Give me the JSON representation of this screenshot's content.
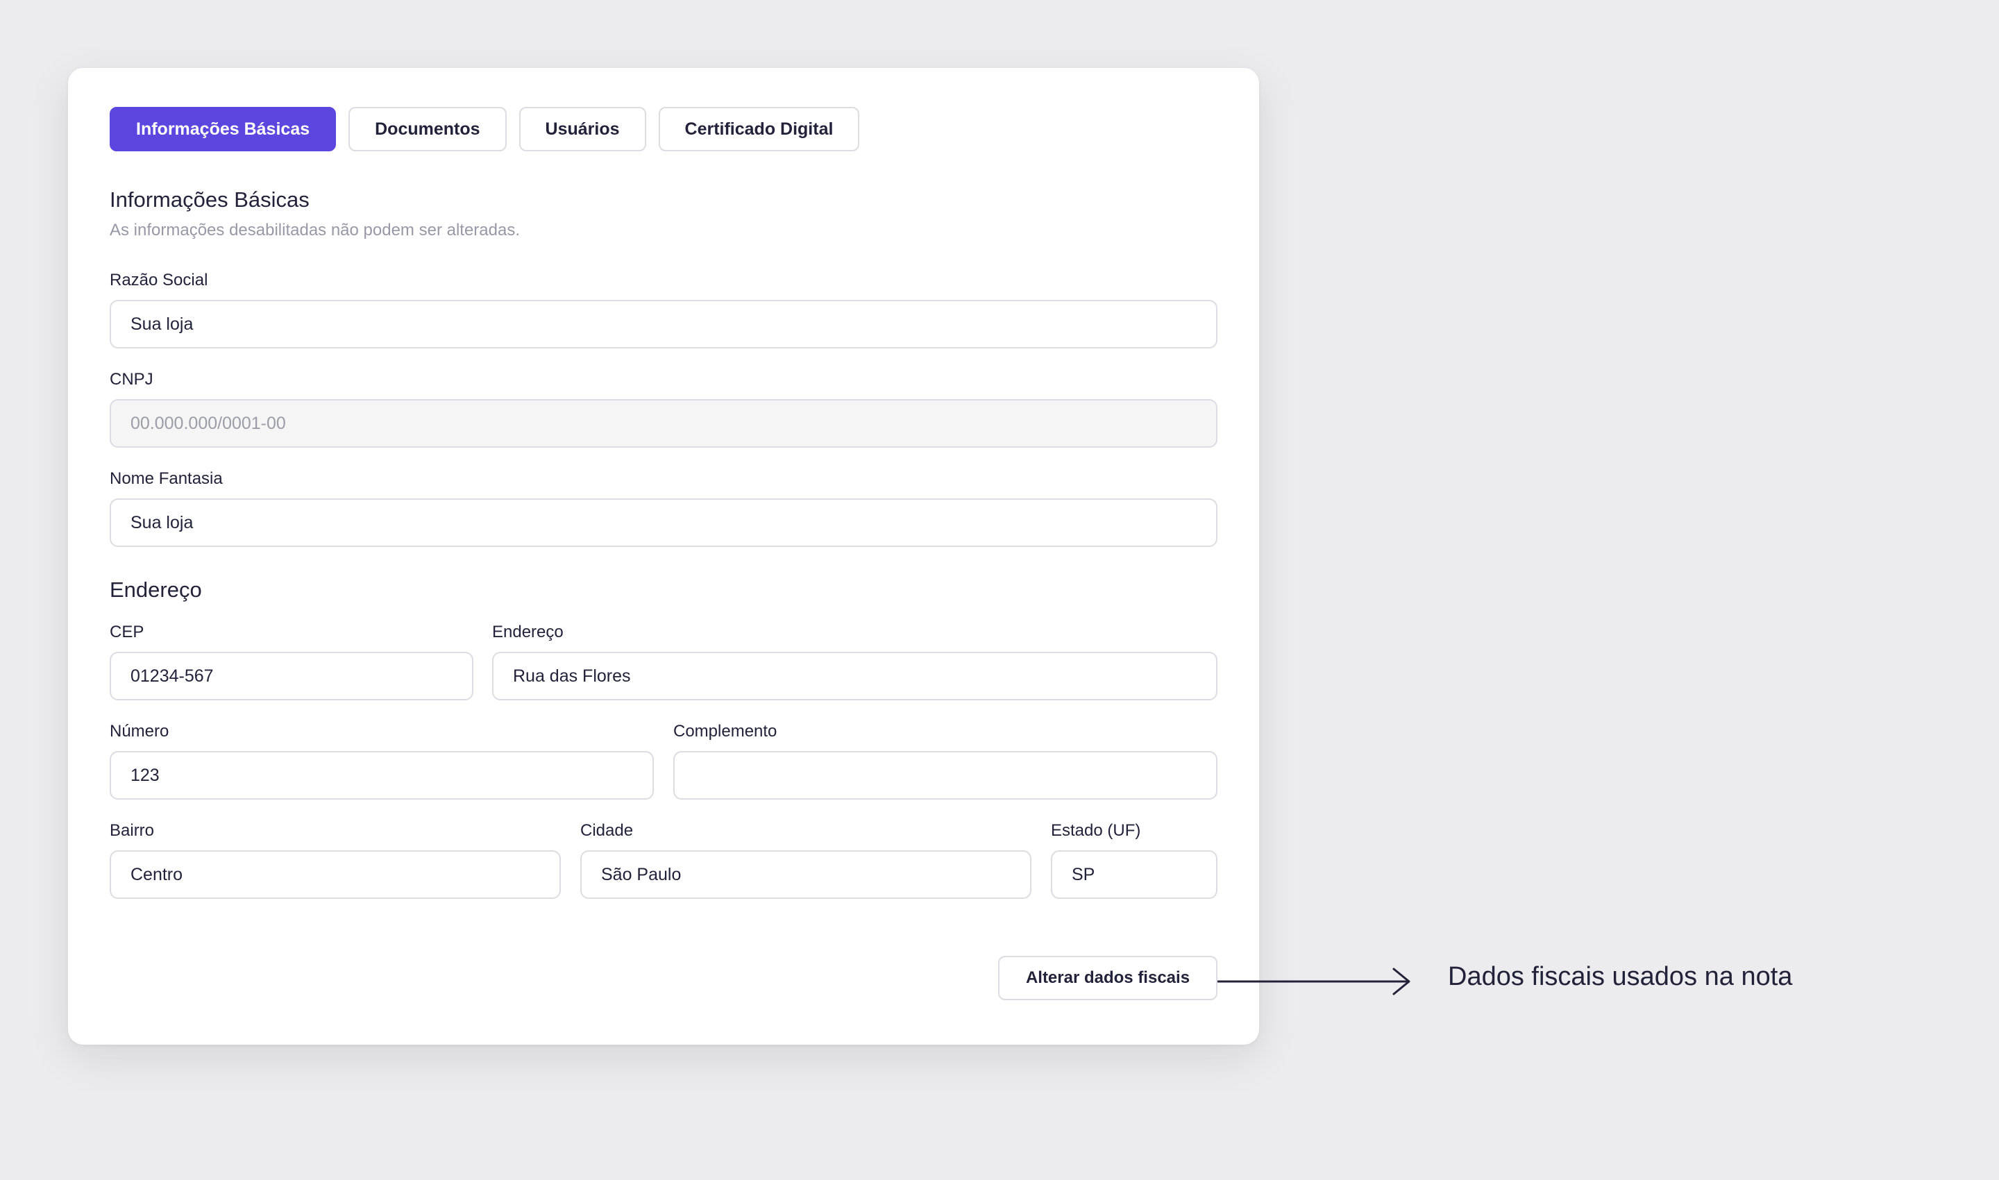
{
  "tabs": [
    {
      "label": "Informações Básicas",
      "active": true
    },
    {
      "label": "Documentos",
      "active": false
    },
    {
      "label": "Usuários",
      "active": false
    },
    {
      "label": "Certificado Digital",
      "active": false
    }
  ],
  "basic_info": {
    "title": "Informações Básicas",
    "subtitle": "As informações desabilitadas não podem ser alteradas."
  },
  "fields": {
    "razao_social": {
      "label": "Razão Social",
      "value": "Sua loja"
    },
    "cnpj": {
      "label": "CNPJ",
      "value": "00.000.000/0001-00",
      "disabled": true
    },
    "nome_fantasia": {
      "label": "Nome Fantasia",
      "value": "Sua loja"
    }
  },
  "address": {
    "title": "Endereço",
    "cep": {
      "label": "CEP",
      "value": "01234-567"
    },
    "endereco": {
      "label": "Endereço",
      "value": "Rua das Flores"
    },
    "numero": {
      "label": "Número",
      "value": "123"
    },
    "complemento": {
      "label": "Complemento",
      "value": ""
    },
    "bairro": {
      "label": "Bairro",
      "value": "Centro"
    },
    "cidade": {
      "label": "Cidade",
      "value": "São Paulo"
    },
    "estado": {
      "label": "Estado (UF)",
      "value": "SP"
    }
  },
  "actions": {
    "alterar_label": "Alterar dados fiscais"
  },
  "annotation": {
    "text": "Dados fiscais usados na nota"
  },
  "colors": {
    "accent": "#5b47e0",
    "background": "#ececee",
    "card": "#ffffff",
    "border": "#dcdce3",
    "muted_text": "#9898a6"
  }
}
